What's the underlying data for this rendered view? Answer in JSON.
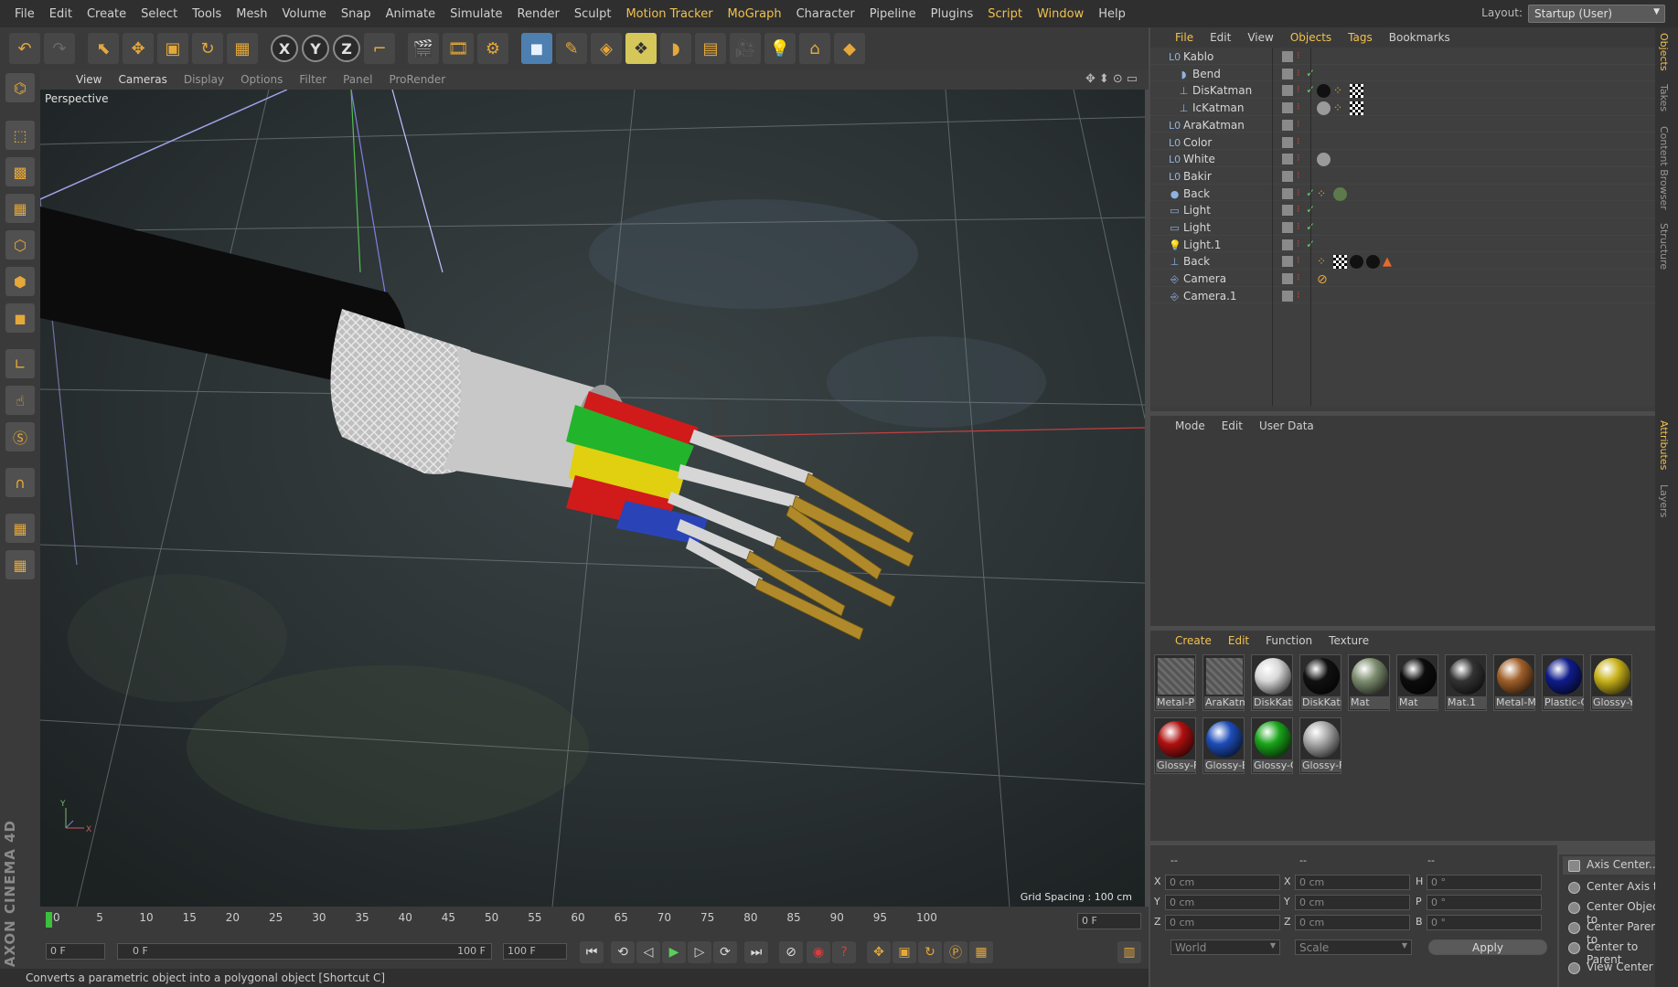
{
  "menubar": {
    "items": [
      "File",
      "Edit",
      "Create",
      "Select",
      "Tools",
      "Mesh",
      "Volume",
      "Snap",
      "Animate",
      "Simulate",
      "Render",
      "Sculpt",
      "Motion Tracker",
      "MoGraph",
      "Character",
      "Pipeline",
      "Plugins",
      "Script",
      "Window",
      "Help"
    ],
    "highlighted": [
      "Motion Tracker",
      "MoGraph",
      "Script",
      "Window"
    ],
    "layout_label": "Layout:",
    "layout_value": "Startup (User)"
  },
  "viewport": {
    "menu": [
      "View",
      "Cameras",
      "Display",
      "Options",
      "Filter",
      "Panel",
      "ProRender"
    ],
    "camera_label": "Perspective",
    "grid_spacing": "Grid Spacing : 100 cm",
    "axis_x": "X",
    "axis_y": "Y"
  },
  "timeline": {
    "ticks": [
      "0",
      "5",
      "10",
      "15",
      "20",
      "25",
      "30",
      "35",
      "40",
      "45",
      "50",
      "55",
      "60",
      "65",
      "70",
      "75",
      "80",
      "85",
      "90",
      "95",
      "100"
    ],
    "current_frame": "0 F",
    "start_frame": "0 F",
    "range_start": "0 F",
    "range_end": "100 F",
    "end_frame": "100 F"
  },
  "status": "Converts a parametric object into a polygonal object [Shortcut C]",
  "objects_panel": {
    "menu": [
      "File",
      "Edit",
      "View",
      "Objects",
      "Tags",
      "Bookmarks"
    ],
    "active_menu": [
      "File",
      "Objects",
      "Tags"
    ],
    "rows": [
      {
        "name": "Kablo",
        "icon": "null-icon",
        "indent": 0,
        "tags": []
      },
      {
        "name": "Bend",
        "icon": "bend-icon",
        "indent": 1,
        "tags": []
      },
      {
        "name": "DisKatman",
        "icon": "sweep-icon",
        "indent": 1,
        "tags": [
          "black-sphere",
          "dots",
          "checker"
        ]
      },
      {
        "name": "IcKatman",
        "icon": "sweep-icon",
        "indent": 1,
        "tags": [
          "gray-sphere",
          "dots",
          "checker"
        ]
      },
      {
        "name": "AraKatman",
        "icon": "null-icon",
        "indent": 0,
        "tags": []
      },
      {
        "name": "Color",
        "icon": "null-icon",
        "indent": 0,
        "tags": []
      },
      {
        "name": "White",
        "icon": "null-icon",
        "indent": 0,
        "tags": [
          "gray-sphere"
        ]
      },
      {
        "name": "Bakir",
        "icon": "null-icon",
        "indent": 0,
        "tags": []
      },
      {
        "name": "Back",
        "icon": "sky-icon",
        "indent": 0,
        "tags": [
          "dots",
          "green-sphere"
        ]
      },
      {
        "name": "Light",
        "icon": "area-light-icon",
        "indent": 0,
        "tags": []
      },
      {
        "name": "Light",
        "icon": "area-light-icon",
        "indent": 0,
        "tags": []
      },
      {
        "name": "Light.1",
        "icon": "bulb-icon",
        "indent": 0,
        "tags": []
      },
      {
        "name": "Back",
        "icon": "sweep-icon",
        "indent": 0,
        "tags": [
          "dots",
          "checker",
          "black-sphere",
          "black-sphere",
          "orange-triangle"
        ]
      },
      {
        "name": "Camera",
        "icon": "camera-icon",
        "indent": 0,
        "tags": [
          "forbidden-icon"
        ]
      },
      {
        "name": "Camera.1",
        "icon": "camera-icon",
        "indent": 0,
        "tags": []
      }
    ]
  },
  "attributes_panel": {
    "menu": [
      "Mode",
      "Edit",
      "User Data"
    ]
  },
  "material_panel": {
    "menu": [
      "Create",
      "Edit",
      "Function",
      "Texture"
    ],
    "active_menu": [
      "Create",
      "Edit"
    ],
    "materials": [
      {
        "label": "Metal-P",
        "color": "#5e5e5e"
      },
      {
        "label": "AraKatm",
        "color": "#6a6a6a"
      },
      {
        "label": "DiskKatı",
        "color": "#d8d8d8"
      },
      {
        "label": "DiskKatı",
        "color": "#111111"
      },
      {
        "label": "Mat",
        "color": "#7e8e70"
      },
      {
        "label": "Mat",
        "color": "#0c0c0c"
      },
      {
        "label": "Mat.1",
        "color": "#333333"
      },
      {
        "label": "Metal-M",
        "color": "#a0602a"
      },
      {
        "label": "Plastic-C",
        "color": "#0f1c8a"
      },
      {
        "label": "Glossy-Y",
        "color": "#c8b21a"
      },
      {
        "label": "Glossy-F",
        "color": "#b01010"
      },
      {
        "label": "Glossy-E",
        "color": "#1e4db8"
      },
      {
        "label": "Glossy-C",
        "color": "#1aa41a"
      },
      {
        "label": "Glossy-F",
        "color": "#a8a8a8"
      }
    ]
  },
  "coordinates": {
    "header": [
      "--",
      "--",
      "--"
    ],
    "rows": [
      {
        "l1": "X",
        "v1": "0 cm",
        "l2": "X",
        "v2": "0 cm",
        "l3": "H",
        "v3": "0 °"
      },
      {
        "l1": "Y",
        "v1": "0 cm",
        "l2": "Y",
        "v2": "0 cm",
        "l3": "P",
        "v3": "0 °"
      },
      {
        "l1": "Z",
        "v1": "0 cm",
        "l2": "Z",
        "v2": "0 cm",
        "l3": "B",
        "v3": "0 °"
      }
    ],
    "mode": "World",
    "scale": "Scale",
    "apply": "Apply"
  },
  "axis_center": {
    "title": "Axis Center...",
    "items": [
      "Center Axis to",
      "Center Object to",
      "Center Parent to",
      "Center to Parent",
      "View Center"
    ]
  },
  "side_tabs": [
    "Objects",
    "Takes",
    "Content Browser",
    "Structure",
    "Attributes",
    "Layers"
  ]
}
